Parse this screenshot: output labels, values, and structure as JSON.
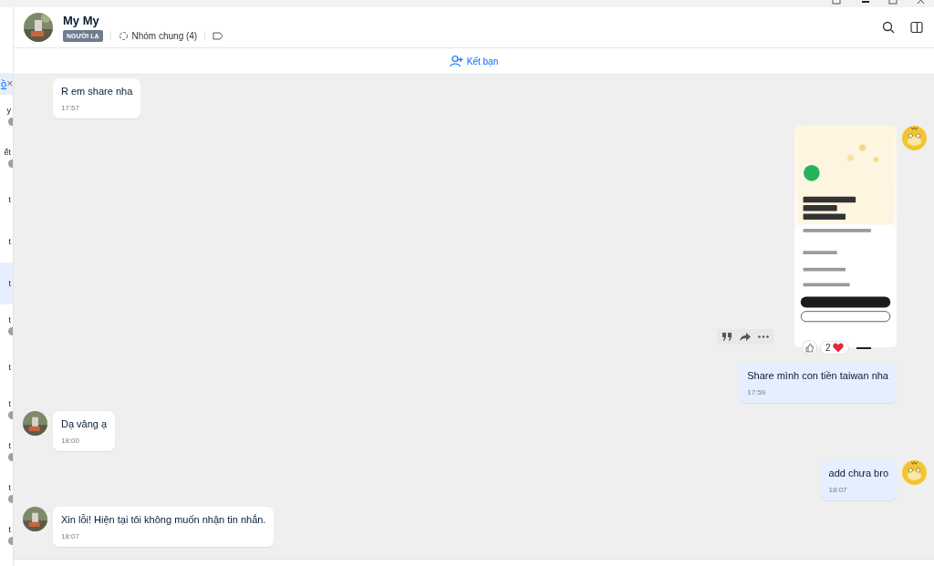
{
  "sidebar": {
    "link": "ồ",
    "close_label": "×",
    "items": [
      {
        "label": "y",
        "selected": false,
        "badge": true
      },
      {
        "label": "ết",
        "selected": false,
        "badge": true
      },
      {
        "label": "t",
        "selected": false,
        "badge": false
      },
      {
        "label": "t",
        "selected": false,
        "badge": false
      },
      {
        "label": "t",
        "selected": true,
        "badge": false
      },
      {
        "label": "t",
        "selected": false,
        "badge": true
      },
      {
        "label": "t",
        "selected": false,
        "badge": false
      },
      {
        "label": "t",
        "selected": false,
        "badge": true
      },
      {
        "label": "t",
        "selected": false,
        "badge": true
      },
      {
        "label": "t",
        "selected": false,
        "badge": true
      },
      {
        "label": "t",
        "selected": false,
        "badge": true
      }
    ]
  },
  "header": {
    "name": "My My",
    "tag": "NGƯỜI LẠ",
    "common_groups": "Nhóm chung (4)"
  },
  "add_friend": "Kết bạn",
  "messages": [
    {
      "outgoing": false,
      "kind": "text",
      "text": "R em share nha",
      "time": "17:57",
      "avatar": false
    },
    {
      "outgoing": true,
      "avatar": true,
      "reaction_count": "2"
    },
    {
      "outgoing": true,
      "kind": "text",
      "text": "Share mình con tiền taiwan nha",
      "time": "17:59",
      "avatar": false
    },
    {
      "outgoing": false,
      "kind": "text",
      "text": "Dạ vâng ạ",
      "time": "18:00",
      "avatar": true
    },
    {
      "outgoing": true,
      "kind": "text",
      "text": "add chưa bro",
      "time": "18:07",
      "avatar": true
    },
    {
      "outgoing": false,
      "kind": "text",
      "text": "Xin lỗi! Hiện tại tôi không muốn nhận tin nhắn.",
      "time": "18:07",
      "avatar": true
    }
  ]
}
